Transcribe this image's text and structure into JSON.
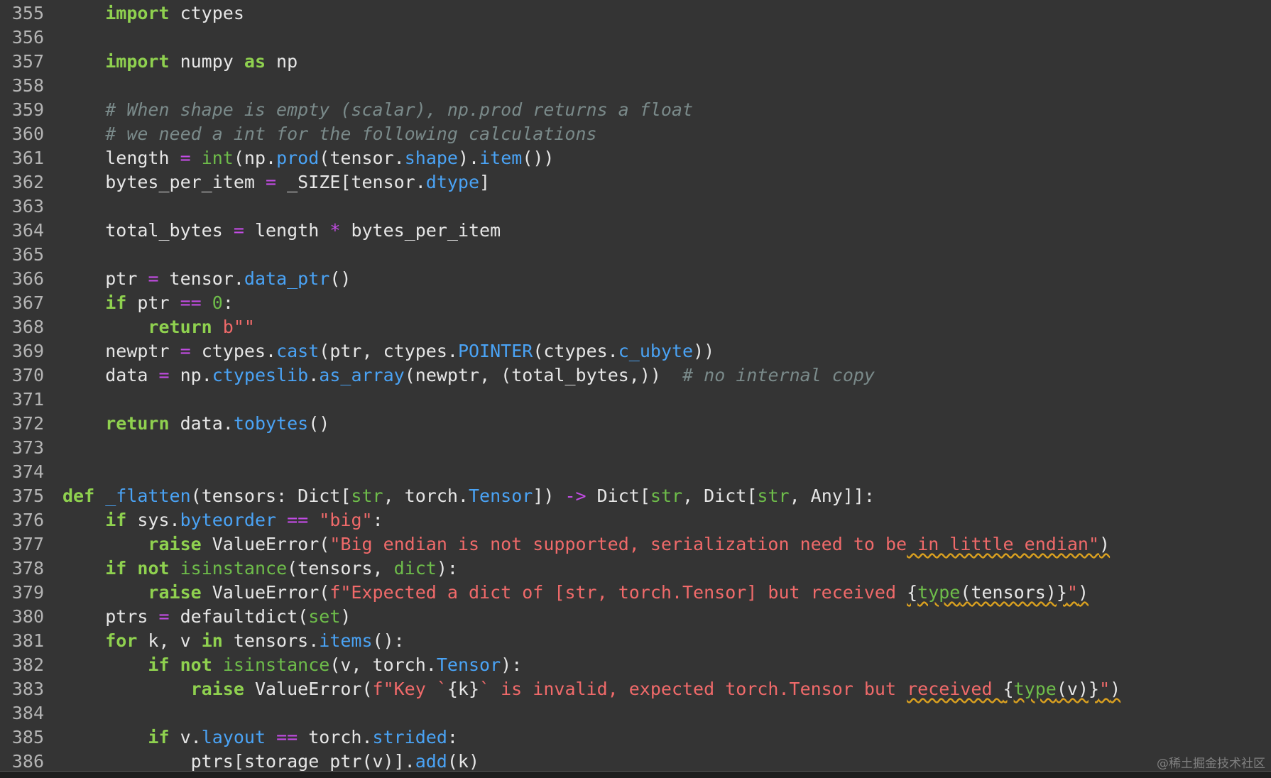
{
  "editor": {
    "lines": [
      {
        "n": "355",
        "indent": "    ",
        "tokens": [
          {
            "t": "import",
            "c": "kw"
          },
          {
            "t": " ctypes",
            "c": "tx"
          }
        ]
      },
      {
        "n": "356",
        "indent": "",
        "tokens": []
      },
      {
        "n": "357",
        "indent": "    ",
        "tokens": [
          {
            "t": "import",
            "c": "kw"
          },
          {
            "t": " numpy ",
            "c": "tx"
          },
          {
            "t": "as",
            "c": "kw"
          },
          {
            "t": " np",
            "c": "tx"
          }
        ]
      },
      {
        "n": "358",
        "indent": "",
        "tokens": []
      },
      {
        "n": "359",
        "indent": "    ",
        "tokens": [
          {
            "t": "# When shape is empty (scalar), np.prod returns a float",
            "c": "cm"
          }
        ]
      },
      {
        "n": "360",
        "indent": "    ",
        "tokens": [
          {
            "t": "# we need a int for the following calculations",
            "c": "cm"
          }
        ]
      },
      {
        "n": "361",
        "indent": "    ",
        "tokens": [
          {
            "t": "length ",
            "c": "tx"
          },
          {
            "t": "=",
            "c": "op"
          },
          {
            "t": " ",
            "c": "tx"
          },
          {
            "t": "int",
            "c": "bi"
          },
          {
            "t": "(np.",
            "c": "tx"
          },
          {
            "t": "prod",
            "c": "fn"
          },
          {
            "t": "(tensor.",
            "c": "tx"
          },
          {
            "t": "shape",
            "c": "fn"
          },
          {
            "t": ").",
            "c": "tx"
          },
          {
            "t": "item",
            "c": "fn"
          },
          {
            "t": "())",
            "c": "tx"
          }
        ]
      },
      {
        "n": "362",
        "indent": "    ",
        "tokens": [
          {
            "t": "bytes_per_item ",
            "c": "tx"
          },
          {
            "t": "=",
            "c": "op"
          },
          {
            "t": " _SIZE[tensor.",
            "c": "tx"
          },
          {
            "t": "dtype",
            "c": "fn"
          },
          {
            "t": "]",
            "c": "tx"
          }
        ]
      },
      {
        "n": "363",
        "indent": "",
        "tokens": []
      },
      {
        "n": "364",
        "indent": "    ",
        "tokens": [
          {
            "t": "total_bytes ",
            "c": "tx"
          },
          {
            "t": "=",
            "c": "op"
          },
          {
            "t": " length ",
            "c": "tx"
          },
          {
            "t": "*",
            "c": "op"
          },
          {
            "t": " bytes_per_item",
            "c": "tx"
          }
        ]
      },
      {
        "n": "365",
        "indent": "",
        "tokens": []
      },
      {
        "n": "366",
        "indent": "    ",
        "tokens": [
          {
            "t": "ptr ",
            "c": "tx"
          },
          {
            "t": "=",
            "c": "op"
          },
          {
            "t": " tensor.",
            "c": "tx"
          },
          {
            "t": "data_ptr",
            "c": "fn"
          },
          {
            "t": "()",
            "c": "tx"
          }
        ]
      },
      {
        "n": "367",
        "indent": "    ",
        "tokens": [
          {
            "t": "if",
            "c": "kw"
          },
          {
            "t": " ptr ",
            "c": "tx"
          },
          {
            "t": "==",
            "c": "op"
          },
          {
            "t": " ",
            "c": "tx"
          },
          {
            "t": "0",
            "c": "num"
          },
          {
            "t": ":",
            "c": "tx"
          }
        ]
      },
      {
        "n": "368",
        "indent": "        ",
        "tokens": [
          {
            "t": "return",
            "c": "kw"
          },
          {
            "t": " ",
            "c": "tx"
          },
          {
            "t": "b\"\"",
            "c": "str"
          }
        ]
      },
      {
        "n": "369",
        "indent": "    ",
        "tokens": [
          {
            "t": "newptr ",
            "c": "tx"
          },
          {
            "t": "=",
            "c": "op"
          },
          {
            "t": " ctypes.",
            "c": "tx"
          },
          {
            "t": "cast",
            "c": "fn"
          },
          {
            "t": "(ptr, ctypes.",
            "c": "tx"
          },
          {
            "t": "POINTER",
            "c": "fn"
          },
          {
            "t": "(ctypes.",
            "c": "tx"
          },
          {
            "t": "c_ubyte",
            "c": "fn"
          },
          {
            "t": "))",
            "c": "tx"
          }
        ]
      },
      {
        "n": "370",
        "indent": "    ",
        "tokens": [
          {
            "t": "data ",
            "c": "tx"
          },
          {
            "t": "=",
            "c": "op"
          },
          {
            "t": " np.",
            "c": "tx"
          },
          {
            "t": "ctypeslib",
            "c": "fn"
          },
          {
            "t": ".",
            "c": "tx"
          },
          {
            "t": "as_array",
            "c": "fn"
          },
          {
            "t": "(newptr, (total_bytes,))  ",
            "c": "tx"
          },
          {
            "t": "# no internal copy",
            "c": "cm"
          }
        ]
      },
      {
        "n": "371",
        "indent": "",
        "tokens": []
      },
      {
        "n": "372",
        "indent": "    ",
        "tokens": [
          {
            "t": "return",
            "c": "kw"
          },
          {
            "t": " data.",
            "c": "tx"
          },
          {
            "t": "tobytes",
            "c": "fn"
          },
          {
            "t": "()",
            "c": "tx"
          }
        ]
      },
      {
        "n": "373",
        "indent": "",
        "tokens": []
      },
      {
        "n": "374",
        "indent": "",
        "tokens": []
      },
      {
        "n": "375",
        "indent": "",
        "tokens": [
          {
            "t": "def",
            "c": "kw"
          },
          {
            "t": " ",
            "c": "tx"
          },
          {
            "t": "_flatten",
            "c": "fn"
          },
          {
            "t": "(tensors: Dict[",
            "c": "tx"
          },
          {
            "t": "str",
            "c": "bi"
          },
          {
            "t": ", torch.",
            "c": "tx"
          },
          {
            "t": "Tensor",
            "c": "fn"
          },
          {
            "t": "]) ",
            "c": "tx"
          },
          {
            "t": "->",
            "c": "op"
          },
          {
            "t": " Dict[",
            "c": "tx"
          },
          {
            "t": "str",
            "c": "bi"
          },
          {
            "t": ", Dict[",
            "c": "tx"
          },
          {
            "t": "str",
            "c": "bi"
          },
          {
            "t": ", Any]]:",
            "c": "tx"
          }
        ]
      },
      {
        "n": "376",
        "indent": "    ",
        "tokens": [
          {
            "t": "if",
            "c": "kw"
          },
          {
            "t": " sys.",
            "c": "tx"
          },
          {
            "t": "byteorder",
            "c": "fn"
          },
          {
            "t": " ",
            "c": "tx"
          },
          {
            "t": "==",
            "c": "op"
          },
          {
            "t": " ",
            "c": "tx"
          },
          {
            "t": "\"big\"",
            "c": "str"
          },
          {
            "t": ":",
            "c": "tx"
          }
        ]
      },
      {
        "n": "377",
        "indent": "        ",
        "tokens": [
          {
            "t": "raise",
            "c": "kw"
          },
          {
            "t": " ValueError(",
            "c": "tx"
          },
          {
            "t": "\"Big endian is not supported, serialization need to be",
            "c": "str"
          },
          {
            "t": " in little endian\"",
            "c": "str warn"
          },
          {
            "t": ")",
            "c": "tx warn"
          }
        ]
      },
      {
        "n": "378",
        "indent": "    ",
        "tokens": [
          {
            "t": "if",
            "c": "kw"
          },
          {
            "t": " ",
            "c": "tx"
          },
          {
            "t": "not",
            "c": "kw"
          },
          {
            "t": " ",
            "c": "tx"
          },
          {
            "t": "isinstance",
            "c": "bi"
          },
          {
            "t": "(tensors, ",
            "c": "tx"
          },
          {
            "t": "dict",
            "c": "bi"
          },
          {
            "t": "):",
            "c": "tx"
          }
        ]
      },
      {
        "n": "379",
        "indent": "        ",
        "tokens": [
          {
            "t": "raise",
            "c": "kw"
          },
          {
            "t": " ValueError(",
            "c": "tx"
          },
          {
            "t": "f\"Expected a dict of [str, torch.Tensor] but received ",
            "c": "str"
          },
          {
            "t": "{",
            "c": "tx warn"
          },
          {
            "t": "type",
            "c": "bi warn"
          },
          {
            "t": "(tensors)}",
            "c": "tx warn"
          },
          {
            "t": "\"",
            "c": "str warn"
          },
          {
            "t": ")",
            "c": "tx warn"
          }
        ]
      },
      {
        "n": "380",
        "indent": "    ",
        "tokens": [
          {
            "t": "ptrs ",
            "c": "tx"
          },
          {
            "t": "=",
            "c": "op"
          },
          {
            "t": " defaultdict(",
            "c": "tx"
          },
          {
            "t": "set",
            "c": "bi"
          },
          {
            "t": ")",
            "c": "tx"
          }
        ]
      },
      {
        "n": "381",
        "indent": "    ",
        "tokens": [
          {
            "t": "for",
            "c": "kw"
          },
          {
            "t": " k, v ",
            "c": "tx"
          },
          {
            "t": "in",
            "c": "kw"
          },
          {
            "t": " tensors.",
            "c": "tx"
          },
          {
            "t": "items",
            "c": "fn"
          },
          {
            "t": "():",
            "c": "tx"
          }
        ]
      },
      {
        "n": "382",
        "indent": "        ",
        "tokens": [
          {
            "t": "if",
            "c": "kw"
          },
          {
            "t": " ",
            "c": "tx"
          },
          {
            "t": "not",
            "c": "kw"
          },
          {
            "t": " ",
            "c": "tx"
          },
          {
            "t": "isinstance",
            "c": "bi"
          },
          {
            "t": "(v, torch.",
            "c": "tx"
          },
          {
            "t": "Tensor",
            "c": "fn"
          },
          {
            "t": "):",
            "c": "tx"
          }
        ]
      },
      {
        "n": "383",
        "indent": "            ",
        "tokens": [
          {
            "t": "raise",
            "c": "kw"
          },
          {
            "t": " ValueError(",
            "c": "tx"
          },
          {
            "t": "f\"Key `",
            "c": "str"
          },
          {
            "t": "{k}",
            "c": "tx"
          },
          {
            "t": "` is invalid, expected torch.Tensor but ",
            "c": "str"
          },
          {
            "t": "received ",
            "c": "str warn"
          },
          {
            "t": "{",
            "c": "tx warn"
          },
          {
            "t": "type",
            "c": "bi warn"
          },
          {
            "t": "(v)}",
            "c": "tx warn"
          },
          {
            "t": "\"",
            "c": "str warn"
          },
          {
            "t": ")",
            "c": "tx warn"
          }
        ]
      },
      {
        "n": "384",
        "indent": "",
        "tokens": []
      },
      {
        "n": "385",
        "indent": "        ",
        "tokens": [
          {
            "t": "if",
            "c": "kw"
          },
          {
            "t": " v.",
            "c": "tx"
          },
          {
            "t": "layout",
            "c": "fn"
          },
          {
            "t": " ",
            "c": "tx"
          },
          {
            "t": "==",
            "c": "op"
          },
          {
            "t": " torch.",
            "c": "tx"
          },
          {
            "t": "strided",
            "c": "fn"
          },
          {
            "t": ":",
            "c": "tx"
          }
        ]
      },
      {
        "n": "386",
        "indent": "            ",
        "tokens": [
          {
            "t": "ptrs[storage_ptr(v)].",
            "c": "tx"
          },
          {
            "t": "add",
            "c": "fn"
          },
          {
            "t": "(k)",
            "c": "tx"
          }
        ]
      }
    ]
  },
  "watermark": "@稀土掘金技术社区",
  "colors": {
    "background": "#343434",
    "keyword": "#8fd14f",
    "function": "#4aa3f5",
    "builtin": "#6ebd4a",
    "operator": "#c44ce6",
    "string": "#f06a6a",
    "comment": "#7a8a8a",
    "line_number": "#b4b4b4"
  }
}
